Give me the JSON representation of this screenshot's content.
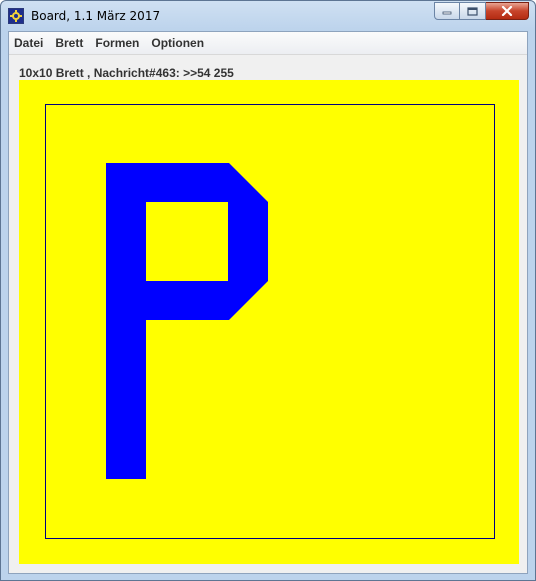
{
  "window": {
    "title": "Board, 1.1 März 2017",
    "app_icon": "board-app-icon",
    "caption_buttons": [
      {
        "name": "minimize",
        "icon": "minimize-icon"
      },
      {
        "name": "maximize",
        "icon": "maximize-icon"
      },
      {
        "name": "close",
        "icon": "close-icon"
      }
    ]
  },
  "menu": {
    "items": [
      "Datei",
      "Brett",
      "Formen",
      "Optionen"
    ]
  },
  "status": {
    "text": "10x10 Brett , Nachricht#463: >>54 255"
  },
  "board": {
    "background_color": "#ffff00",
    "frame_color": "#000080",
    "symbol": "P",
    "symbol_color": "#0000ff"
  }
}
